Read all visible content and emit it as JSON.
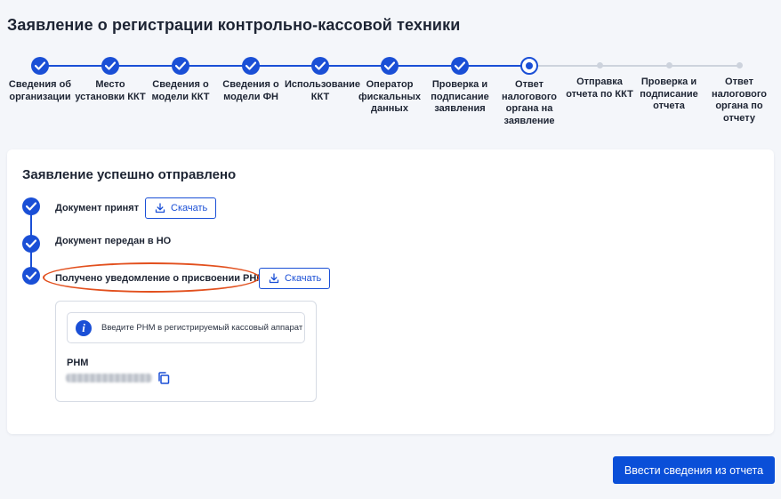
{
  "page": {
    "title": "Заявление о регистрации контрольно-кассовой техники"
  },
  "colors": {
    "accent": "#1a4fd6",
    "highlight": "#e2501e",
    "inactive": "#cdd3dd"
  },
  "stepper": {
    "steps": [
      {
        "label": "Сведения об организации",
        "state": "done"
      },
      {
        "label": "Место установки ККТ",
        "state": "done"
      },
      {
        "label": "Сведения о модели ККТ",
        "state": "done"
      },
      {
        "label": "Сведения о модели ФН",
        "state": "done"
      },
      {
        "label": "Использование ККТ",
        "state": "done"
      },
      {
        "label": "Оператор фискальных данных",
        "state": "done"
      },
      {
        "label": "Проверка и подписание заявления",
        "state": "done"
      },
      {
        "label": "Ответ налогового органа на заявление",
        "state": "current"
      },
      {
        "label": "Отправка отчета по ККТ",
        "state": "todo"
      },
      {
        "label": "Проверка и подписание отчета",
        "state": "todo"
      },
      {
        "label": "Ответ налогового органа по отчету",
        "state": "todo"
      }
    ]
  },
  "card": {
    "title": "Заявление успешно отправлено",
    "timeline": [
      {
        "text": "Документ принят",
        "download": "Скачать"
      },
      {
        "text": "Документ передан в НО"
      },
      {
        "text": "Получено уведомление о присвоении РНМ",
        "download": "Скачать"
      }
    ],
    "rnm": {
      "info": "Введите РНМ в регистрируемый кассовый аппарат",
      "label": "РНМ",
      "copy_icon": "copy-icon"
    }
  },
  "actions": {
    "primary": "Ввести сведения из отчета"
  }
}
